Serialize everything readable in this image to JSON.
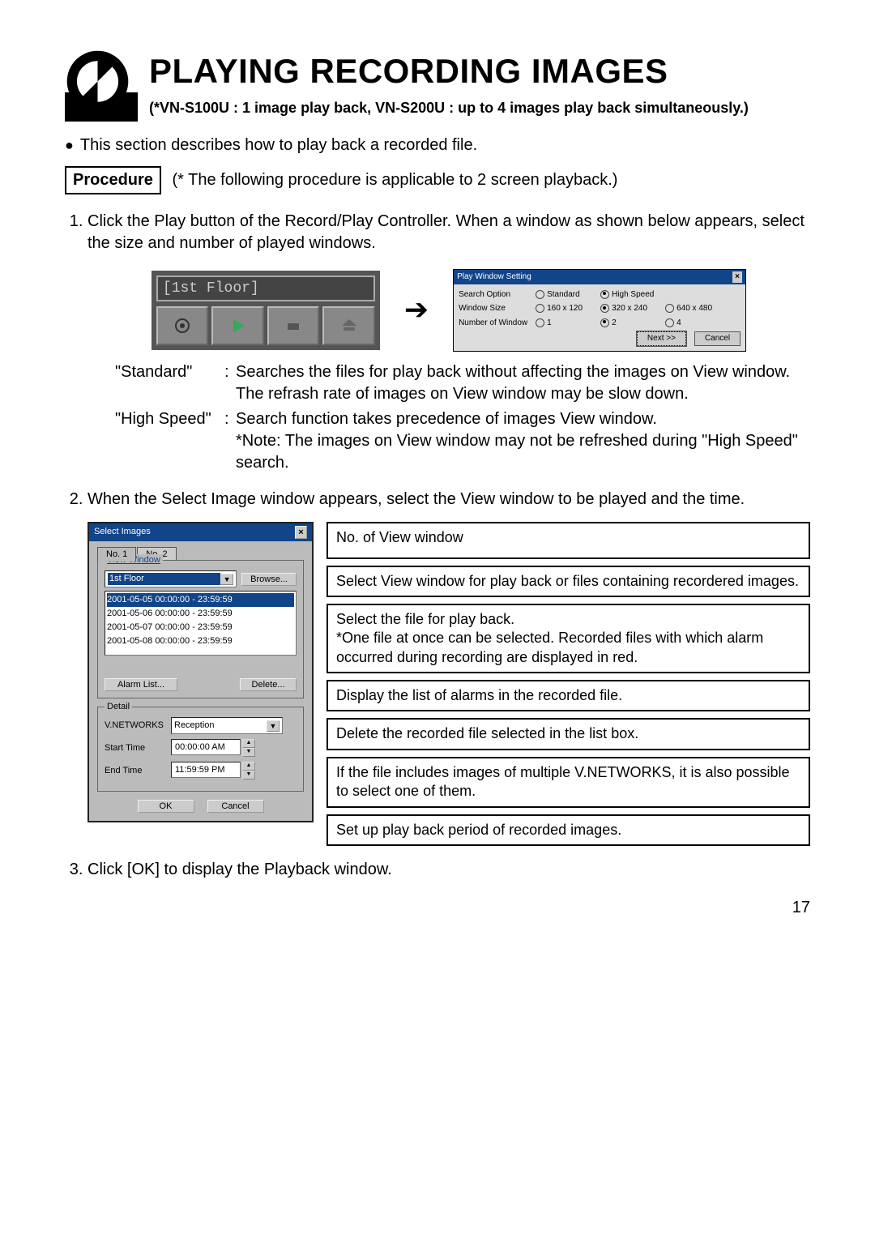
{
  "page_number": "17",
  "title": "PLAYING RECORDING IMAGES",
  "subtitle": "(*VN-S100U : 1 image play back, VN-S200U : up to 4 images play back simultaneously.)",
  "intro_bullet": "This section describes how to play back a recorded file.",
  "procedure_label": "Procedure",
  "procedure_note": "(* The following procedure is applicable to 2 screen playback.)",
  "step1": "Click the Play button of the Record/Play Controller. When a window as shown below appears, select the size and number of played windows.",
  "step2": "When the Select Image window appears, select the View window to be played and the time.",
  "step3": "Click [OK] to display the Playback window.",
  "toolbar": {
    "title": "[1st Floor]"
  },
  "play_window_setting": {
    "title": "Play Window Setting",
    "row1_label": "Search Option",
    "row1_opt1": "Standard",
    "row1_opt2": "High Speed",
    "row2_label": "Window Size",
    "row2_opt1": "160 x 120",
    "row2_opt2": "320 x 240",
    "row2_opt3": "640 x 480",
    "row3_label": "Number of Window",
    "row3_opt1": "1",
    "row3_opt2": "2",
    "row3_opt3": "4",
    "next_button": "Next >>",
    "cancel_button": "Cancel"
  },
  "descriptions": {
    "standard_term": "\"Standard\"",
    "standard_desc": "Searches the files for play back without affecting the images on View window. The refrash rate of images on View window may be slow down.",
    "highspeed_term": "\"High Speed\"",
    "highspeed_desc1": "Search function takes precedence of images View window.",
    "highspeed_desc2": "*Note: The images on View window may not be refreshed during \"High Speed\" search."
  },
  "select_images": {
    "title": "Select Images",
    "tab1": "No. 1",
    "tab2": "No. 2",
    "group_view": "View Window",
    "dropdown_value": "1st Floor",
    "browse_button": "Browse...",
    "files": [
      "2001-05-05 00:00:00 - 23:59:59",
      "2001-05-06 00:00:00 - 23:59:59",
      "2001-05-07 00:00:00 - 23:59:59",
      "2001-05-08 00:00:00 - 23:59:59"
    ],
    "alarm_button": "Alarm List...",
    "delete_button": "Delete...",
    "group_detail": "Detail",
    "detail_label": "V.NETWORKS",
    "detail_value": "Reception",
    "start_label": "Start Time",
    "start_value": "00:00:00 AM",
    "end_label": "End Time",
    "end_value": "11:59:59 PM",
    "ok_button": "OK",
    "cancel_button": "Cancel"
  },
  "callouts": {
    "c1": "No. of View window",
    "c2": "Select View window for play back or files containing recordered images.",
    "c3": "Select the file for play back.\n*One file at once can be selected. Recorded files with which alarm occurred during recording are displayed in red.",
    "c4": "Display the list of alarms in the recorded file.",
    "c5": "Delete the recorded file selected in the list box.",
    "c6": "If the file includes images of multiple V.NETWORKS, it is also possible to select one of them.",
    "c7": "Set up play back period of recorded images."
  }
}
